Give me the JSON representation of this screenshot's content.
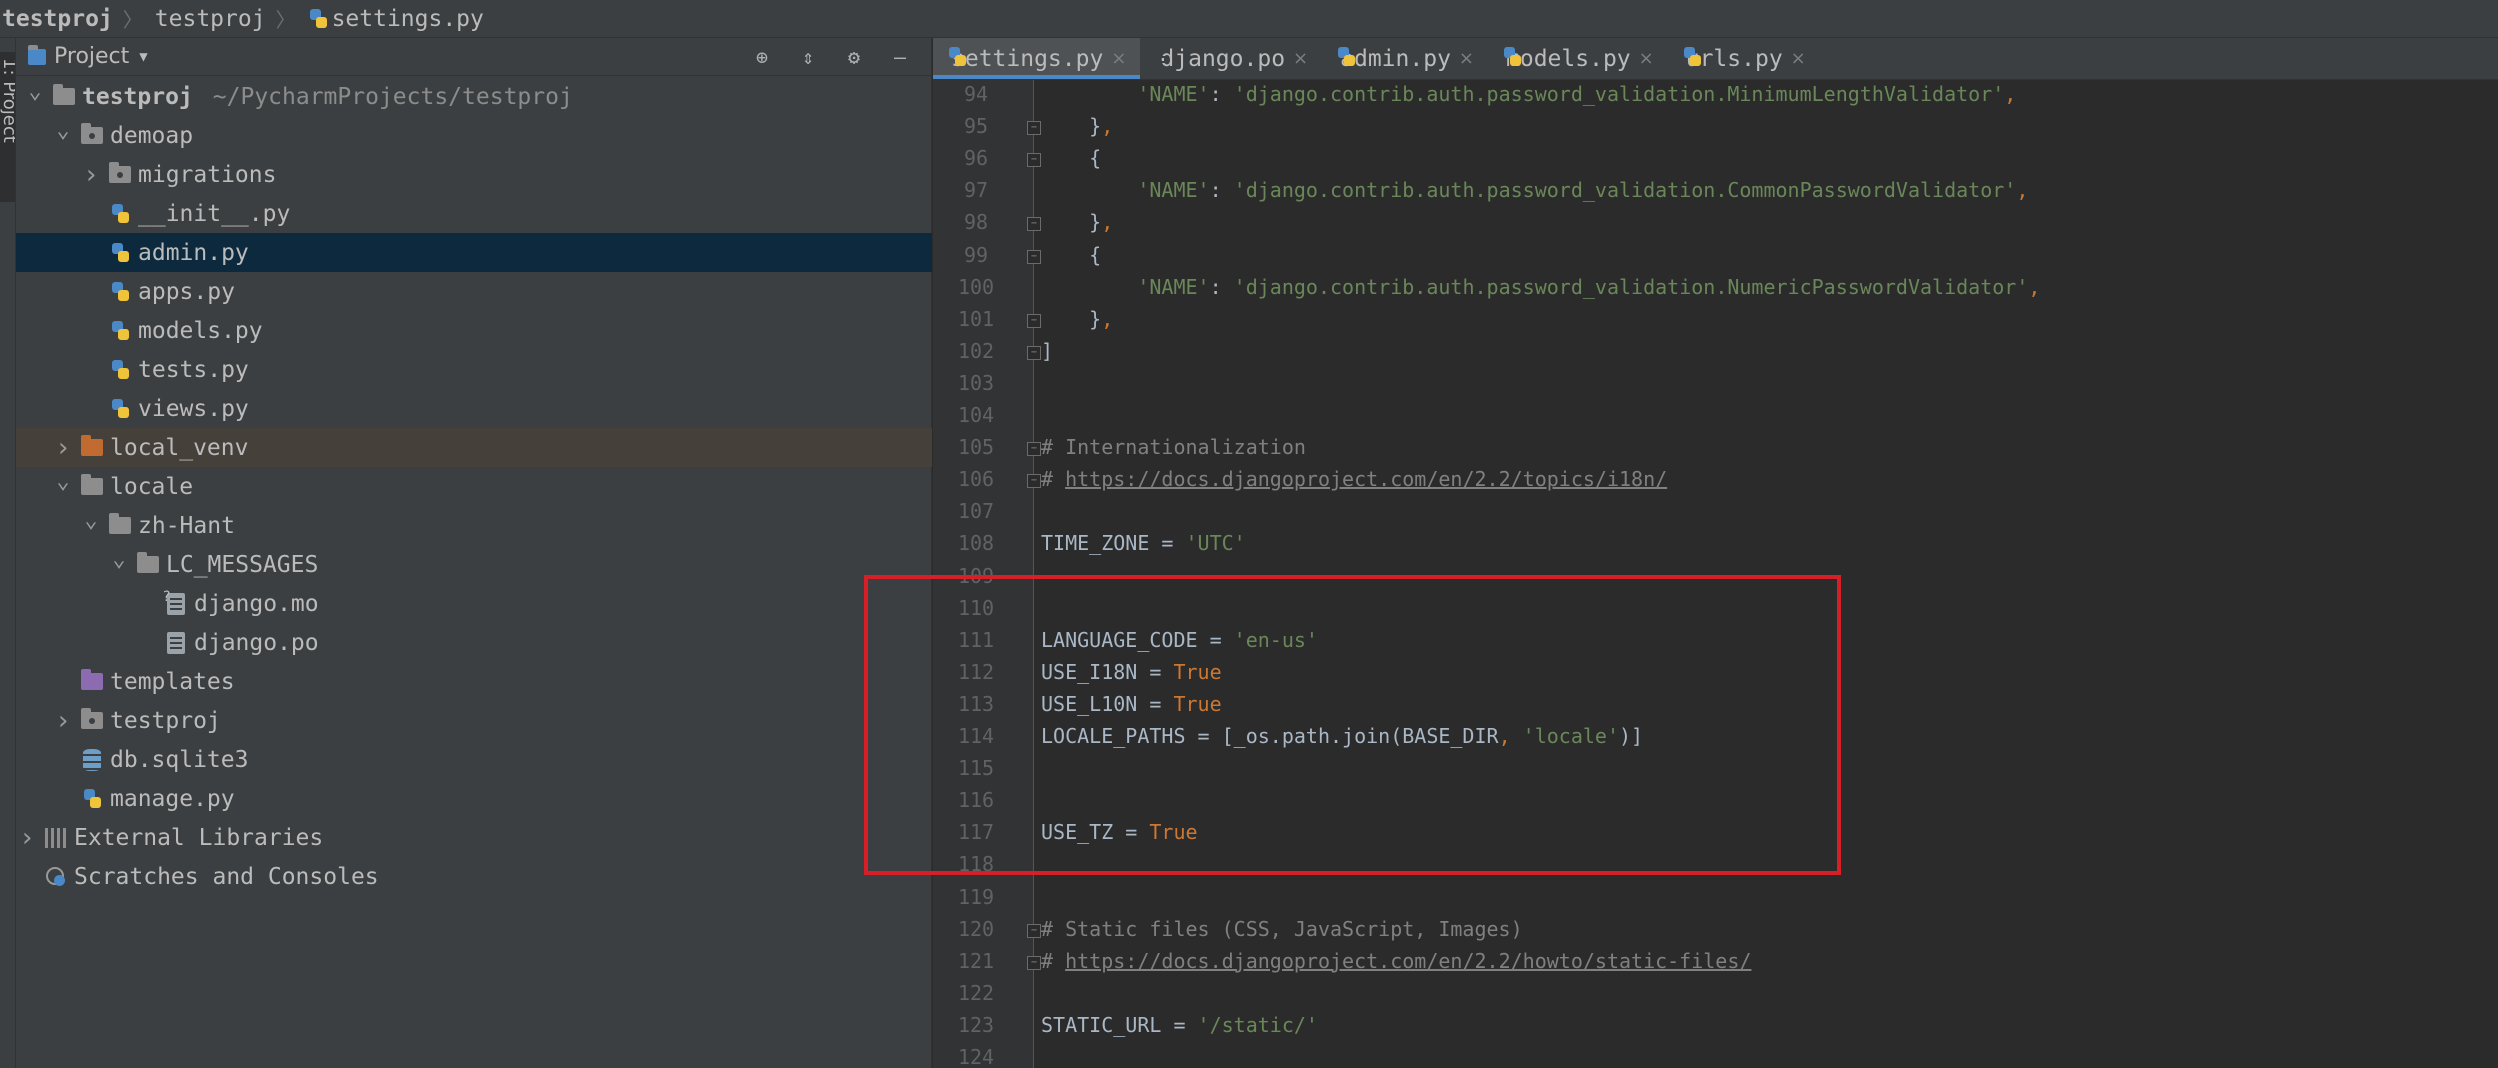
{
  "navbar": {
    "crumbs": [
      "testproj",
      "testproj",
      "settings.py"
    ]
  },
  "toolstrip": {
    "tab_label": "1: Project"
  },
  "project_panel": {
    "title": "Project",
    "tools": [
      "locate-icon",
      "collapse-icon",
      "gear-icon",
      "minimize-icon"
    ],
    "tree": [
      {
        "label": "testproj",
        "path": "~/PycharmProjects/testproj",
        "icon": "folder-icon",
        "expanded": true
      },
      {
        "label": "demoap",
        "icon": "package-folder-icon",
        "expanded": true
      },
      {
        "label": "migrations",
        "icon": "package-folder-icon",
        "expanded": false
      },
      {
        "label": "__init__.py",
        "icon": "python-file-icon"
      },
      {
        "label": "admin.py",
        "icon": "python-file-icon",
        "selected": true
      },
      {
        "label": "apps.py",
        "icon": "python-file-icon"
      },
      {
        "label": "models.py",
        "icon": "python-file-icon"
      },
      {
        "label": "tests.py",
        "icon": "python-file-icon"
      },
      {
        "label": "views.py",
        "icon": "python-file-icon"
      },
      {
        "label": "local_venv",
        "icon": "excluded-folder-icon",
        "expanded": false
      },
      {
        "label": "locale",
        "icon": "folder-icon",
        "expanded": true
      },
      {
        "label": "zh-Hant",
        "icon": "folder-icon",
        "expanded": true
      },
      {
        "label": "LC_MESSAGES",
        "icon": "folder-icon",
        "expanded": true
      },
      {
        "label": "django.mo",
        "icon": "mo-file-icon"
      },
      {
        "label": "django.po",
        "icon": "po-file-icon"
      },
      {
        "label": "templates",
        "icon": "templates-folder-icon"
      },
      {
        "label": "testproj",
        "icon": "package-folder-icon",
        "expanded": false
      },
      {
        "label": "db.sqlite3",
        "icon": "database-icon"
      },
      {
        "label": "manage.py",
        "icon": "python-file-icon"
      },
      {
        "label": "External Libraries",
        "icon": "libraries-icon",
        "expanded": false
      },
      {
        "label": "Scratches and Consoles",
        "icon": "scratches-icon"
      }
    ]
  },
  "tabs": [
    {
      "label": "settings.py",
      "icon": "python-file-icon",
      "active": true
    },
    {
      "label": "django.po",
      "icon": "po-file-icon"
    },
    {
      "label": "admin.py",
      "icon": "python-file-icon"
    },
    {
      "label": "models.py",
      "icon": "python-file-icon"
    },
    {
      "label": "urls.py",
      "icon": "python-file-icon"
    }
  ],
  "editor": {
    "lines": [
      {
        "n": "94",
        "code": "        'NAME': 'django.contrib.auth.password_validation.MinimumLengthValidator',"
      },
      {
        "n": "95",
        "code": "    },"
      },
      {
        "n": "96",
        "code": "    {"
      },
      {
        "n": "97",
        "code": "        'NAME': 'django.contrib.auth.password_validation.CommonPasswordValidator',"
      },
      {
        "n": "98",
        "code": "    },"
      },
      {
        "n": "99",
        "code": "    {"
      },
      {
        "n": "100",
        "code": "        'NAME': 'django.contrib.auth.password_validation.NumericPasswordValidator',"
      },
      {
        "n": "101",
        "code": "    },"
      },
      {
        "n": "102",
        "code": "]"
      },
      {
        "n": "103",
        "code": ""
      },
      {
        "n": "104",
        "code": ""
      },
      {
        "n": "105",
        "code": "# Internationalization"
      },
      {
        "n": "106",
        "code": "# https://docs.djangoproject.com/en/2.2/topics/i18n/"
      },
      {
        "n": "107",
        "code": ""
      },
      {
        "n": "108",
        "code": "TIME_ZONE = 'UTC'"
      },
      {
        "n": "109",
        "code": ""
      },
      {
        "n": "110",
        "code": ""
      },
      {
        "n": "111",
        "code": "LANGUAGE_CODE = 'en-us'"
      },
      {
        "n": "112",
        "code": "USE_I18N = True"
      },
      {
        "n": "113",
        "code": "USE_L10N = True"
      },
      {
        "n": "114",
        "code": "LOCALE_PATHS = [_os.path.join(BASE_DIR, 'locale')]"
      },
      {
        "n": "115",
        "code": ""
      },
      {
        "n": "116",
        "code": ""
      },
      {
        "n": "117",
        "code": "USE_TZ = True"
      },
      {
        "n": "118",
        "code": ""
      },
      {
        "n": "119",
        "code": ""
      },
      {
        "n": "120",
        "code": "# Static files (CSS, JavaScript, Images)"
      },
      {
        "n": "121",
        "code": "# https://docs.djangoproject.com/en/2.2/howto/static-files/"
      },
      {
        "n": "122",
        "code": ""
      },
      {
        "n": "123",
        "code": "STATIC_URL = '/static/'"
      },
      {
        "n": "124",
        "code": ""
      }
    ],
    "highlight_color": "#d71f27"
  },
  "colors": {
    "selection": "#0d293e",
    "excluded_row": "#45403a",
    "string": "#6a8759",
    "keyword": "#cc7832",
    "comment": "#808080"
  }
}
